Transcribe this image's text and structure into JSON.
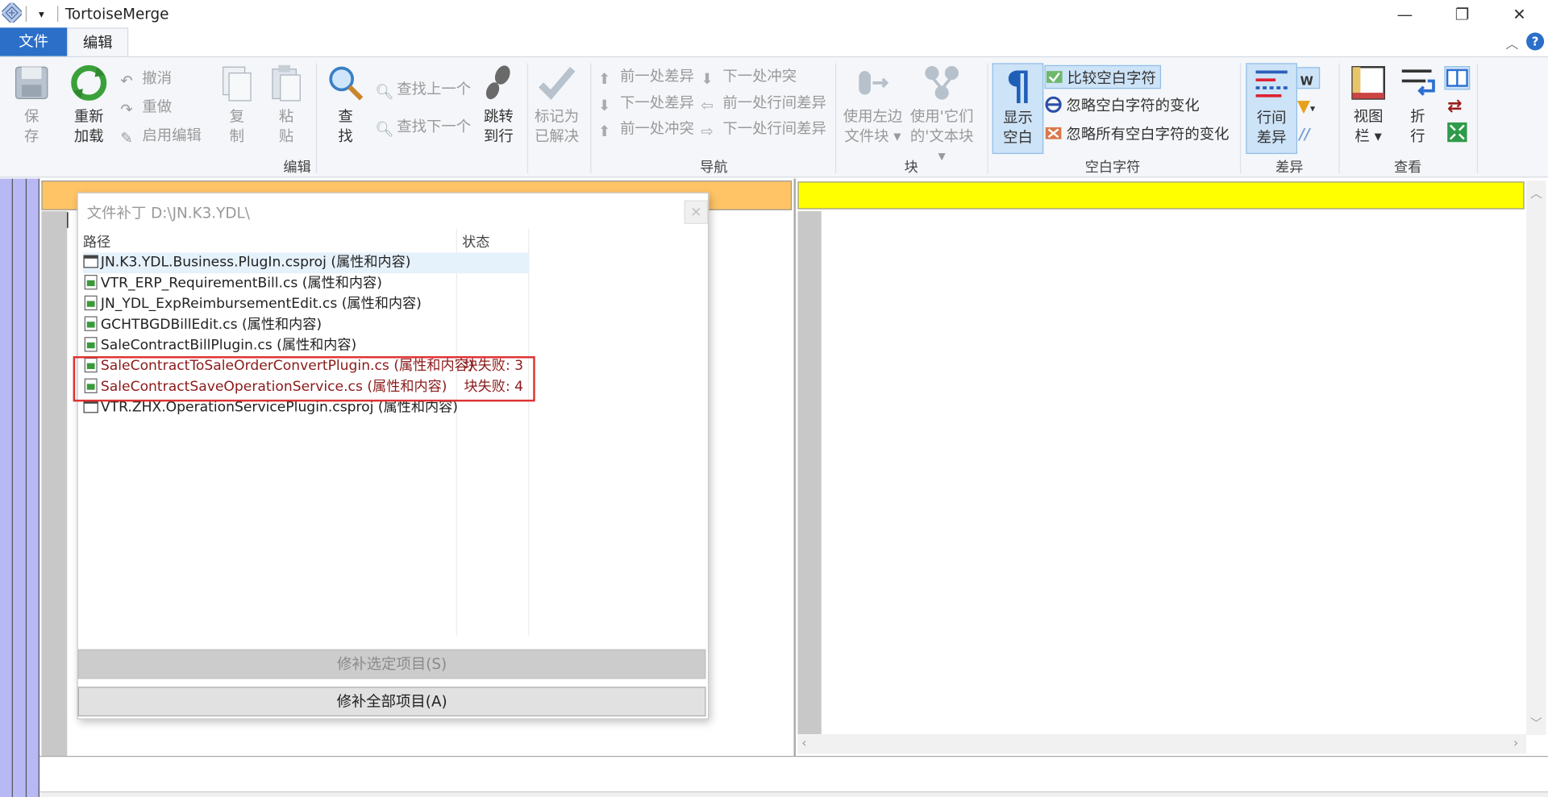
{
  "window": {
    "title": "TortoiseMerge",
    "minimize": "—",
    "restore": "❐",
    "close": "✕"
  },
  "quick_access": {
    "dropdown": "▾"
  },
  "tabs": {
    "file": "文件",
    "edit": "编辑"
  },
  "ribbon_extras": {
    "collapse": "︿",
    "help": "?"
  },
  "ribbon": {
    "edit_group": {
      "label": "编辑",
      "save_l1": "保",
      "save_l2": "存",
      "reload_l1": "重新",
      "reload_l2": "加载",
      "undo": "撤消",
      "redo": "重做",
      "enable_edit": "启用编辑",
      "copy_l1": "复",
      "copy_l2": "制",
      "paste_l1": "粘",
      "paste_l2": "贴",
      "find_l1": "查",
      "find_l2": "找",
      "find_prev": "查找上一个",
      "find_next": "查找下一个",
      "goto_l1": "跳转",
      "goto_l2": "到行",
      "mark_l1": "标记为",
      "mark_l2": "已解决"
    },
    "nav_group": {
      "label": "导航",
      "prev_diff": "前一处差异",
      "next_conflict": "下一处冲突",
      "next_diff": "下一处差异",
      "prev_inline_diff": "前一处行间差异",
      "prev_conflict": "前一处冲突",
      "next_inline_diff": "下一处行间差异"
    },
    "block_group": {
      "label": "块",
      "use_left_l1": "使用左边",
      "use_left_l2": "文件块",
      "use_their_l1": "使用'它们",
      "use_their_l2": "的'文本块"
    },
    "whitespace_group": {
      "label": "空白字符",
      "show_ws_l1": "显示",
      "show_ws_l2": "空白",
      "compare_ws": "比较空白字符",
      "ignore_ws_change": "忽略空白字符的变化",
      "ignore_all_ws": "忽略所有空白字符的变化"
    },
    "diff_group": {
      "label": "差异",
      "inline_l1": "行间",
      "inline_l2": "差异"
    },
    "view_group": {
      "label": "查看",
      "viewbar_l1": "视图",
      "viewbar_l2": "栏",
      "wrap_l1": "折",
      "wrap_l2": "行"
    }
  },
  "dialog": {
    "title": "文件补丁  D:\\JN.K3.YDL\\",
    "close": "×",
    "col_path": "路径",
    "col_status": "状态",
    "files": [
      {
        "name": "JN.K3.YDL.Business.PlugIn.csproj",
        "attr": "(属性和内容)",
        "status": ""
      },
      {
        "name": "VTR_ERP_RequirementBill.cs",
        "attr": "(属性和内容)",
        "status": ""
      },
      {
        "name": "JN_YDL_ExpReimbursementEdit.cs",
        "attr": "(属性和内容)",
        "status": ""
      },
      {
        "name": "GCHTBGDBillEdit.cs",
        "attr": "(属性和内容)",
        "status": ""
      },
      {
        "name": "SaleContractBillPlugin.cs",
        "attr": "(属性和内容)",
        "status": ""
      },
      {
        "name": "SaleContractToSaleOrderConvertPlugin.cs",
        "attr": "(属性和内容)",
        "status": "块失败: 3"
      },
      {
        "name": "SaleContractSaveOperationService.cs",
        "attr": "(属性和内容)",
        "status": "块失败: 4"
      },
      {
        "name": "VTR.ZHX.OperationServicePlugin.csproj",
        "attr": "(属性和内容)",
        "status": ""
      }
    ],
    "patch_selected": "修补选定项目(S)",
    "patch_all": "修补全部项目(A)"
  },
  "colors": {
    "file_tab": "#2b6fc9",
    "left_header": "#ffc466",
    "right_header": "#ffff00",
    "margin": "#b8b8f5",
    "error_text": "#8b1a1a",
    "highlight_box": "#e03131"
  }
}
